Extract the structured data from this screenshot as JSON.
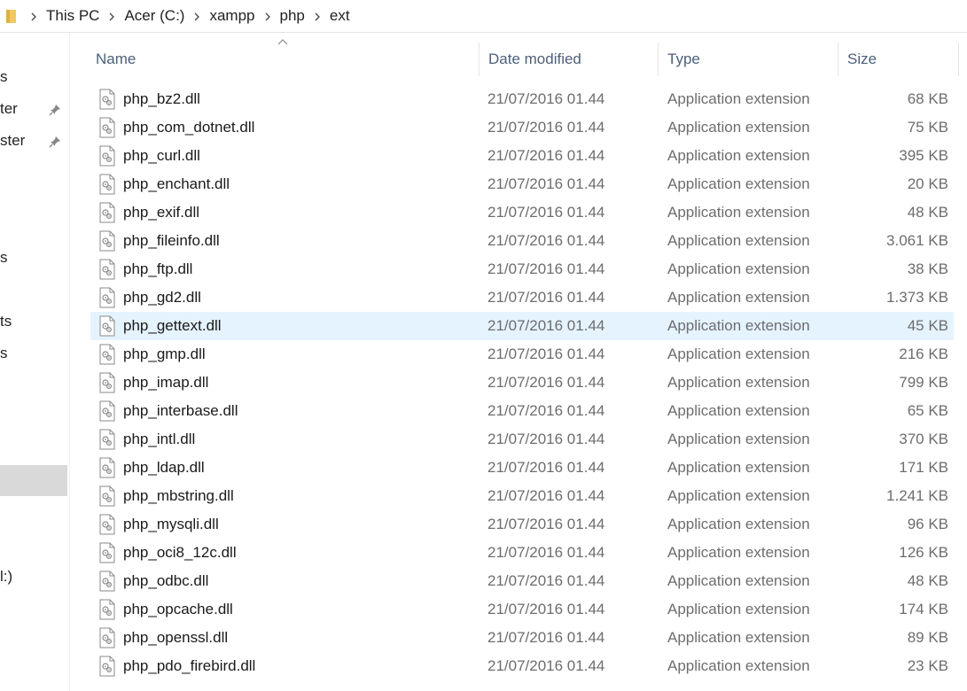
{
  "breadcrumb": [
    "This PC",
    "Acer (C:)",
    "xampp",
    "php",
    "ext"
  ],
  "nav_items": [
    {
      "label": "s",
      "pinned": false
    },
    {
      "label": "ter",
      "pinned": true
    },
    {
      "label": "ster",
      "pinned": true
    },
    {
      "label": "s",
      "pinned": false
    },
    {
      "label": "ts",
      "pinned": false
    },
    {
      "label": "s",
      "pinned": false
    },
    {
      "label": "l:)",
      "pinned": false
    }
  ],
  "columns": {
    "name": "Name",
    "date": "Date modified",
    "type": "Type",
    "size": "Size"
  },
  "sort": {
    "column": "name",
    "direction": "ascending"
  },
  "files": [
    {
      "name": "php_bz2.dll",
      "date": "21/07/2016 01.44",
      "type": "Application extension",
      "size": "68 KB"
    },
    {
      "name": "php_com_dotnet.dll",
      "date": "21/07/2016 01.44",
      "type": "Application extension",
      "size": "75 KB"
    },
    {
      "name": "php_curl.dll",
      "date": "21/07/2016 01.44",
      "type": "Application extension",
      "size": "395 KB"
    },
    {
      "name": "php_enchant.dll",
      "date": "21/07/2016 01.44",
      "type": "Application extension",
      "size": "20 KB"
    },
    {
      "name": "php_exif.dll",
      "date": "21/07/2016 01.44",
      "type": "Application extension",
      "size": "48 KB"
    },
    {
      "name": "php_fileinfo.dll",
      "date": "21/07/2016 01.44",
      "type": "Application extension",
      "size": "3.061 KB"
    },
    {
      "name": "php_ftp.dll",
      "date": "21/07/2016 01.44",
      "type": "Application extension",
      "size": "38 KB"
    },
    {
      "name": "php_gd2.dll",
      "date": "21/07/2016 01.44",
      "type": "Application extension",
      "size": "1.373 KB"
    },
    {
      "name": "php_gettext.dll",
      "date": "21/07/2016 01.44",
      "type": "Application extension",
      "size": "45 KB",
      "selected": true
    },
    {
      "name": "php_gmp.dll",
      "date": "21/07/2016 01.44",
      "type": "Application extension",
      "size": "216 KB"
    },
    {
      "name": "php_imap.dll",
      "date": "21/07/2016 01.44",
      "type": "Application extension",
      "size": "799 KB"
    },
    {
      "name": "php_interbase.dll",
      "date": "21/07/2016 01.44",
      "type": "Application extension",
      "size": "65 KB"
    },
    {
      "name": "php_intl.dll",
      "date": "21/07/2016 01.44",
      "type": "Application extension",
      "size": "370 KB"
    },
    {
      "name": "php_ldap.dll",
      "date": "21/07/2016 01.44",
      "type": "Application extension",
      "size": "171 KB"
    },
    {
      "name": "php_mbstring.dll",
      "date": "21/07/2016 01.44",
      "type": "Application extension",
      "size": "1.241 KB"
    },
    {
      "name": "php_mysqli.dll",
      "date": "21/07/2016 01.44",
      "type": "Application extension",
      "size": "96 KB"
    },
    {
      "name": "php_oci8_12c.dll",
      "date": "21/07/2016 01.44",
      "type": "Application extension",
      "size": "126 KB"
    },
    {
      "name": "php_odbc.dll",
      "date": "21/07/2016 01.44",
      "type": "Application extension",
      "size": "48 KB"
    },
    {
      "name": "php_opcache.dll",
      "date": "21/07/2016 01.44",
      "type": "Application extension",
      "size": "174 KB"
    },
    {
      "name": "php_openssl.dll",
      "date": "21/07/2016 01.44",
      "type": "Application extension",
      "size": "89 KB"
    },
    {
      "name": "php_pdo_firebird.dll",
      "date": "21/07/2016 01.44",
      "type": "Application extension",
      "size": "23 KB"
    }
  ],
  "colors": {
    "selected_row": "#e5f3ff",
    "header_text": "#4c607a",
    "folder": "#f0c862"
  },
  "icons": {
    "folder": "folder-icon",
    "file": "dll-file-icon",
    "separator": "chevron-right-icon",
    "pin": "pin-icon",
    "sort": "sort-ascending-icon"
  }
}
